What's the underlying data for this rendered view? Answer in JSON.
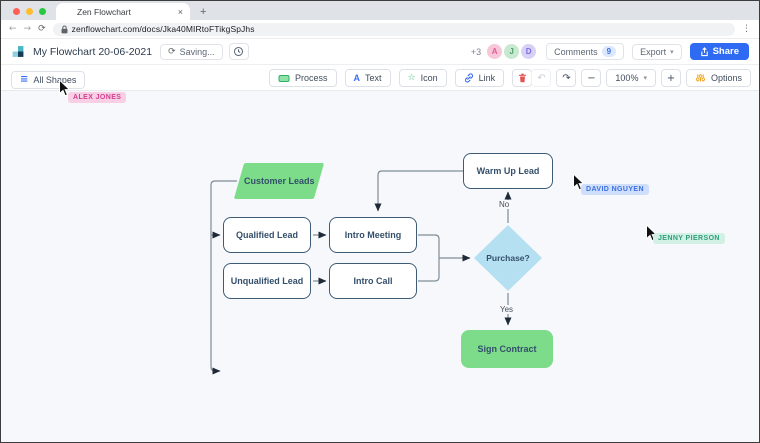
{
  "browser": {
    "tab_title": "Zen Flowchart",
    "url": "zenflowchart.com/docs/Jka40MIRtoFTikgSpJhs"
  },
  "icons": {
    "close": "×",
    "new_tab": "+",
    "back": "←",
    "forward": "→",
    "reload": "⟳",
    "more": "⋮",
    "sync": "⟳",
    "caret": "▾",
    "hamburger": "≡",
    "undo": "↶",
    "redo": "↷",
    "minus": "−",
    "plus": "+",
    "star": "☆",
    "text_glyph": "A"
  },
  "header": {
    "doc_title": "My Flowchart 20-06-2021",
    "saving_label": "Saving...",
    "overflow_count": "+3",
    "avatars": [
      {
        "initial": "A"
      },
      {
        "initial": "J"
      },
      {
        "initial": "D"
      }
    ],
    "comments_label": "Comments",
    "comments_count": "9",
    "export_label": "Export",
    "share_label": "Share"
  },
  "toolbar": {
    "all_shapes_label": "All Shapes",
    "process_label": "Process",
    "text_label": "Text",
    "icon_label": "Icon",
    "link_label": "Link",
    "zoom_level": "100%",
    "options_label": "Options"
  },
  "canvas": {
    "nodes": {
      "customer_leads": "Customer Leads",
      "qualified_lead": "Qualified Lead",
      "unqualified_lead": "Unqualified Lead",
      "intro_meeting": "Intro Meeting",
      "intro_call": "Intro Call",
      "warm_up_lead": "Warm Up Lead",
      "purchase": "Purchase?",
      "sign_contract": "Sign Contract"
    },
    "edges": [
      {
        "from": "customer_leads",
        "to": "qualified_lead",
        "label": ""
      },
      {
        "from": "customer_leads",
        "to": "unqualified_lead",
        "label": ""
      },
      {
        "from": "qualified_lead",
        "to": "intro_meeting",
        "label": ""
      },
      {
        "from": "unqualified_lead",
        "to": "intro_call",
        "label": ""
      },
      {
        "from": "intro_meeting",
        "to": "purchase",
        "label": ""
      },
      {
        "from": "intro_call",
        "to": "purchase",
        "label": ""
      },
      {
        "from": "purchase",
        "to": "warm_up_lead",
        "label": "No"
      },
      {
        "from": "purchase",
        "to": "sign_contract",
        "label": "Yes"
      },
      {
        "from": "warm_up_lead",
        "to": "intro_meeting",
        "label": ""
      }
    ],
    "edge_labels": {
      "no": "No",
      "yes": "Yes"
    },
    "collaborators": [
      {
        "name": "ALEX JONES"
      },
      {
        "name": "DAVID NGUYEN"
      },
      {
        "name": "JENNY PIERSON"
      }
    ]
  },
  "colors": {
    "accent_blue": "#2e6bf2",
    "node_green": "#7cdc8a",
    "node_blue": "#b5e0f2",
    "node_border": "#3d5a76",
    "canvas_bg": "#f6f8fb",
    "chip_pink": "#f8cfe5",
    "chip_blue": "#cfdffb",
    "chip_teal": "#d2f0e3"
  }
}
